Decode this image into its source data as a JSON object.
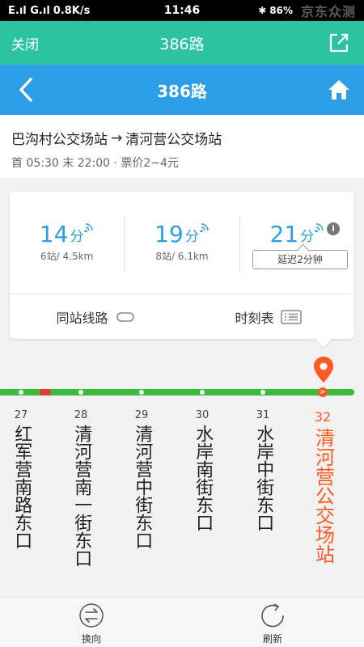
{
  "statusbar": {
    "signal": "E.ıl G.ıl",
    "speed": "0.8K/s",
    "time": "11:46",
    "battery": "86%",
    "watermark": "京东众测"
  },
  "topbar": {
    "close": "关闭",
    "title": "386路"
  },
  "navbar": {
    "title": "386路"
  },
  "route": {
    "from": "巴沟村公交场站",
    "arrow": "→",
    "to": "清河营公交场站",
    "schedule": "首 05:30 末 22:00 · 票价2~4元"
  },
  "arrivals": [
    {
      "minutes": "14",
      "unit": "分",
      "detail": "6站/ 4.5km"
    },
    {
      "minutes": "19",
      "unit": "分",
      "detail": "8站/ 6.1km"
    },
    {
      "minutes": "21",
      "unit": "分",
      "info": "i",
      "delay": "延迟2分钟"
    }
  ],
  "actions": {
    "same_station": "同站线路",
    "timetable": "时刻表"
  },
  "stations": [
    {
      "num": "27",
      "name": "红军营南路东口"
    },
    {
      "num": "28",
      "name": "清河营南一街东口"
    },
    {
      "num": "29",
      "name": "清河营中街东口"
    },
    {
      "num": "30",
      "name": "水岸南街东口"
    },
    {
      "num": "31",
      "name": "水岸中街东口"
    },
    {
      "num": "32",
      "name": "清河营公交场站"
    }
  ],
  "current_marker": ">",
  "bottom": {
    "switch": "换向",
    "refresh": "刷新"
  },
  "colors": {
    "teal": "#2cc3a3",
    "blue": "#2c9ee8",
    "green": "#3cba3c",
    "orange": "#ff5a1f",
    "red": "#e53935"
  }
}
